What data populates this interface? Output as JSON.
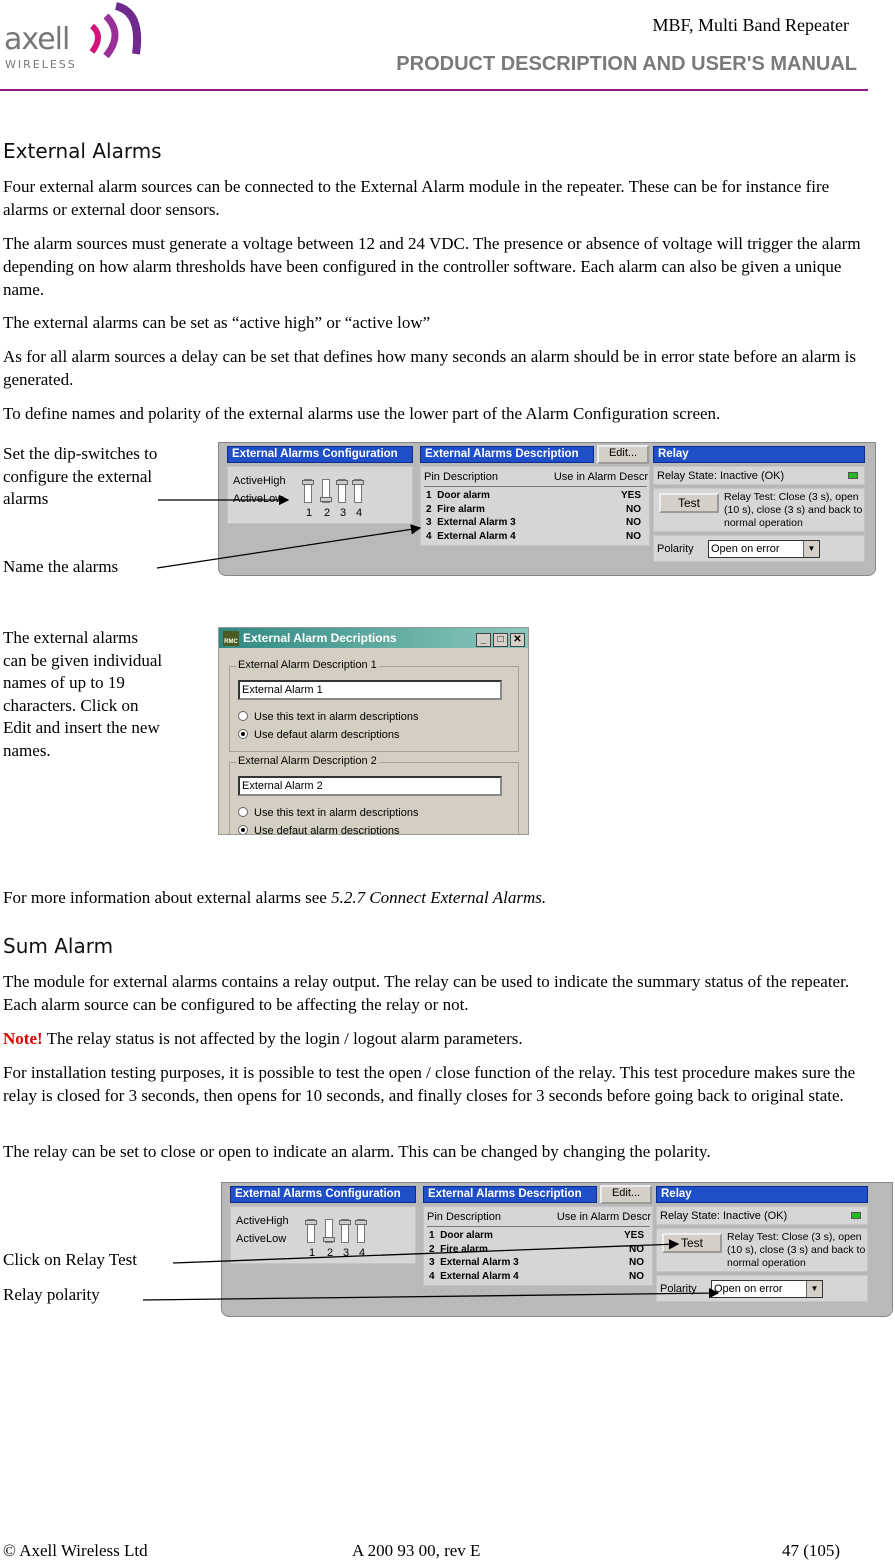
{
  "header": {
    "logo_text": "axell",
    "logo_sub": "WIRELESS",
    "doc_title": "MBF, Multi Band Repeater",
    "manual_title": "PRODUCT DESCRIPTION AND USER'S MANUAL",
    "rule_color": "#8b1a8b"
  },
  "ext": {
    "heading": "External Alarms",
    "p1": "Four external alarm sources can be connected to the External Alarm module in the repeater. These can be for instance fire alarms or external door sensors.",
    "p2": "The alarm sources must generate a voltage between 12 and 24 VDC. The presence or absence of voltage will trigger the alarm depending on how alarm thresholds have been configured in the controller software. Each alarm can also be given a unique name.",
    "p3": "The external alarms can be set as “active high” or “active low”",
    "p4": "As for all alarm sources a delay can be set that defines how many seconds an alarm should be in error state before an alarm is generated.",
    "p5": "To define names and polarity of the external alarms use the lower part of the Alarm Configuration screen.",
    "label_dip": "Set the dip-switches to configure the external alarms",
    "label_name": "Name the alarms",
    "label_names_info": "The external alarms can be given individual names of up to 19 characters. Click on Edit and insert the new names.",
    "more_info_prefix": "For more information about external alarms see ",
    "more_info_ref": "5.2.7  Connect External Alarms."
  },
  "panel": {
    "config_title": "External Alarms Configuration",
    "active_high": "ActiveHigh",
    "active_low": "ActiveLow",
    "switch_numbers": [
      "1",
      "2",
      "3",
      "4"
    ],
    "desc_title": "External Alarms Description",
    "edit_button": "Edit...",
    "col_pin": "Pin Description",
    "col_use": "Use in Alarm Descr",
    "rows": [
      {
        "pin": "1  Door alarm",
        "use": "YES"
      },
      {
        "pin": "2  Fire alarm",
        "use": "NO"
      },
      {
        "pin": "3  External Alarm 3",
        "use": "NO"
      },
      {
        "pin": "4  External Alarm 4",
        "use": "NO"
      }
    ],
    "relay_title": "Relay",
    "relay_state": "Relay State: Inactive (OK)",
    "test_button": "Test",
    "relay_test_info": "Relay Test: Close (3 s), open (10 s), close (3 s) and back to normal operation",
    "polarity_label": "Polarity",
    "polarity_value": "Open on error",
    "led_color": "#22bb22"
  },
  "dialog": {
    "title": "External Alarm Decriptions",
    "icon_text": "RMC",
    "groups": [
      {
        "legend": "External Alarm Description 1",
        "value": "External Alarm 1",
        "opt1": "Use this text in alarm descriptions",
        "opt2": "Use defaut alarm descriptions"
      },
      {
        "legend": "External Alarm Description 2",
        "value": "External Alarm 2",
        "opt1": "Use this text in alarm descriptions",
        "opt2": "Use defaut alarm descriptions"
      }
    ]
  },
  "sum": {
    "heading": "Sum Alarm",
    "p1": "The module for external alarms contains a relay output. The relay can be used to indicate the summary status of the repeater. Each alarm source can be configured to be affecting the relay or not.",
    "note_label": "Note!",
    "note_text": " The relay status is not affected by the login / logout alarm parameters.",
    "p2": "For installation testing purposes, it is possible to test the open / close function of the relay. This test procedure makes sure the relay is closed for 3 seconds, then opens for 10 seconds, and finally closes for 3 seconds before going back to original state.",
    "p3": "The relay can be set to close or open to indicate an alarm. This can be changed by changing the polarity.",
    "label_test": "Click on Relay Test",
    "label_polarity": "Relay polarity"
  },
  "footer": {
    "copyright": "© Axell Wireless Ltd",
    "doc_number": "A 200 93 00, rev E",
    "page": "47 (105)"
  }
}
